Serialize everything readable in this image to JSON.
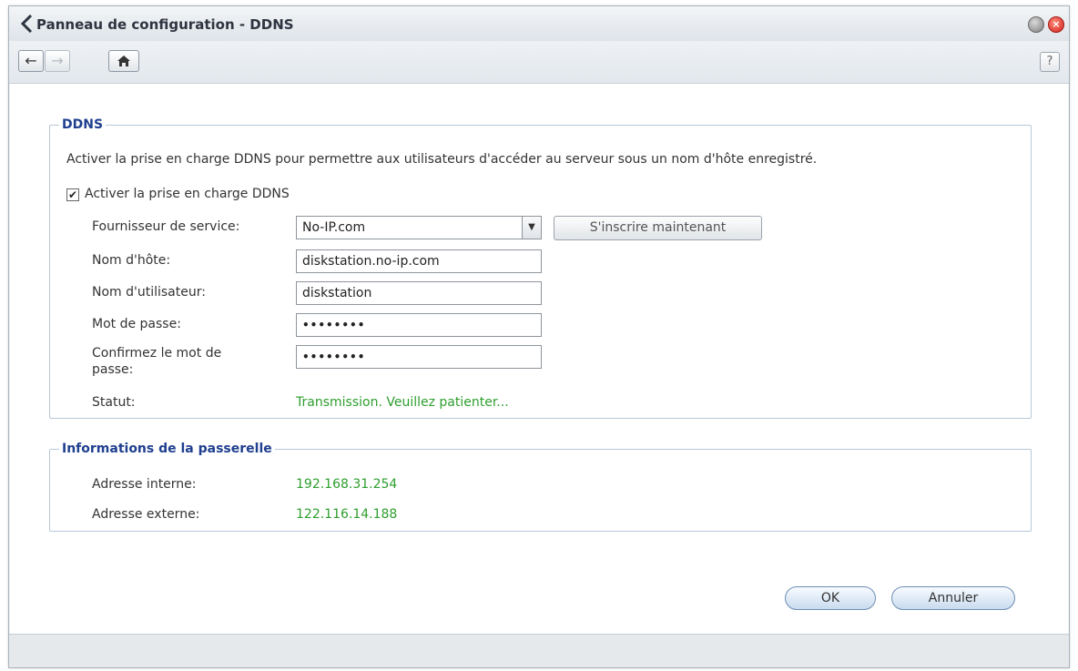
{
  "window": {
    "title": "Panneau de configuration - DDNS"
  },
  "toolbar": {
    "back_icon": "arrow-left-icon",
    "forward_icon": "arrow-right-icon",
    "home_icon": "home-icon",
    "help_label": "?"
  },
  "ddns": {
    "legend": "DDNS",
    "description": "Activer la prise en charge DDNS pour permettre aux utilisateurs d'accéder au serveur sous un nom d'hôte enregistré.",
    "enable_label": "Activer la prise en charge DDNS",
    "enable_checked": true,
    "provider_label": "Fournisseur de service:",
    "provider_value": "No-IP.com",
    "register_button": "S'inscrire maintenant",
    "hostname_label": "Nom d'hôte:",
    "hostname_value": "diskstation.no-ip.com",
    "username_label": "Nom d'utilisateur:",
    "username_value": "diskstation",
    "password_label": "Mot de passe:",
    "password_value": "••••••••",
    "confirm_label_line1": "Confirmez le mot de",
    "confirm_label_line2": "passe:",
    "confirm_value": "••••••••",
    "status_label": "Statut:",
    "status_value": "Transmission. Veuillez patienter..."
  },
  "gateway": {
    "legend": "Informations de la passerelle",
    "internal_label": "Adresse interne:",
    "internal_value": "192.168.31.254",
    "external_label": "Adresse externe:",
    "external_value": "122.116.14.188"
  },
  "footer": {
    "ok_label": "OK",
    "cancel_label": "Annuler"
  },
  "colors": {
    "legend": "#1f3f8f",
    "status_green": "#2e9e2e",
    "group_border": "#b7c9d9"
  }
}
